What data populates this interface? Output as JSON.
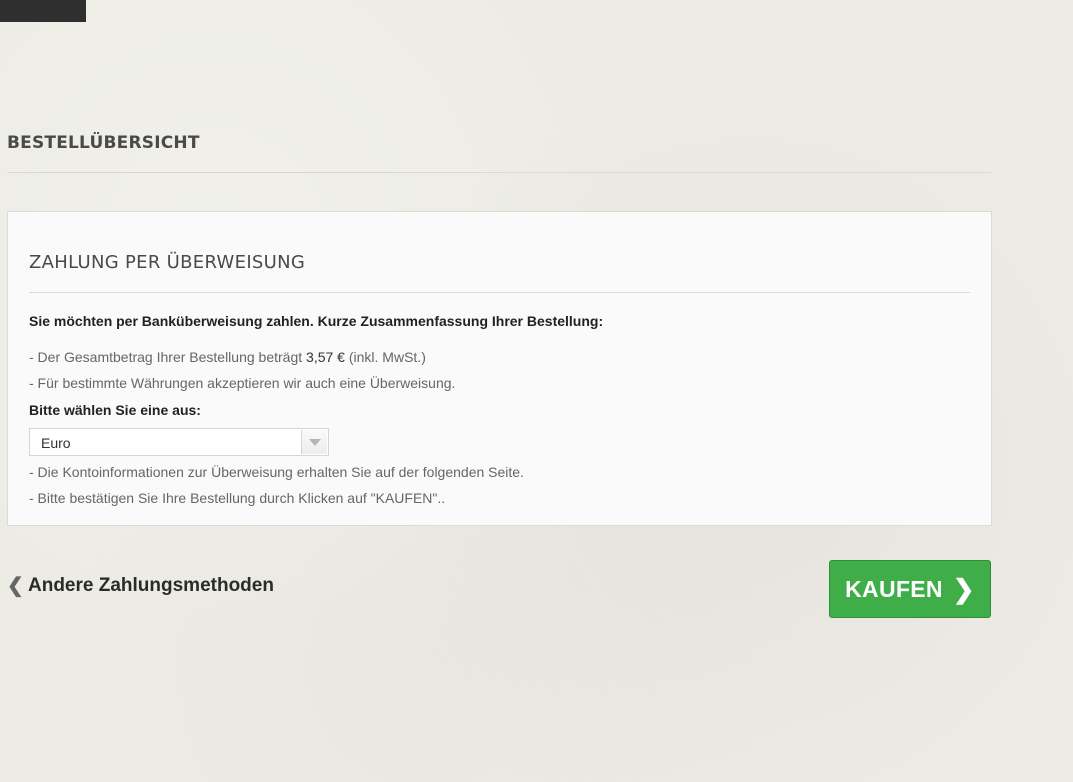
{
  "page": {
    "heading": "BESTELLÜBERSICHT"
  },
  "card": {
    "title": "ZAHLUNG PER ÜBERWEISUNG",
    "intro": "Sie möchten per Banküberweisung zahlen. Kurze Zusammenfassung Ihrer Bestellung:",
    "total_prefix": "- Der Gesamtbetrag Ihrer Bestellung beträgt ",
    "total_amount": "3,57 €",
    "total_suffix": " (inkl. MwSt.)",
    "currency_note": "- Für bestimmte Währungen akzeptieren wir auch eine Überweisung.",
    "select_label": "Bitte wählen Sie eine aus:",
    "currency_selected": "Euro",
    "account_info_note": "- Die Kontoinformationen zur Überweisung erhalten Sie auf der folgenden Seite.",
    "confirm_note": "- Bitte bestätigen Sie Ihre Bestellung durch Klicken auf \"KAUFEN\".."
  },
  "footer": {
    "back_label": "Andere Zahlungsmethoden",
    "back_icon": "chevron-left-icon",
    "buy_label": "KAUFEN",
    "buy_icon": "chevron-right-icon"
  },
  "colors": {
    "buy_button": "#3fae49",
    "background": "#ecebe4",
    "card_background": "#fafafa"
  }
}
